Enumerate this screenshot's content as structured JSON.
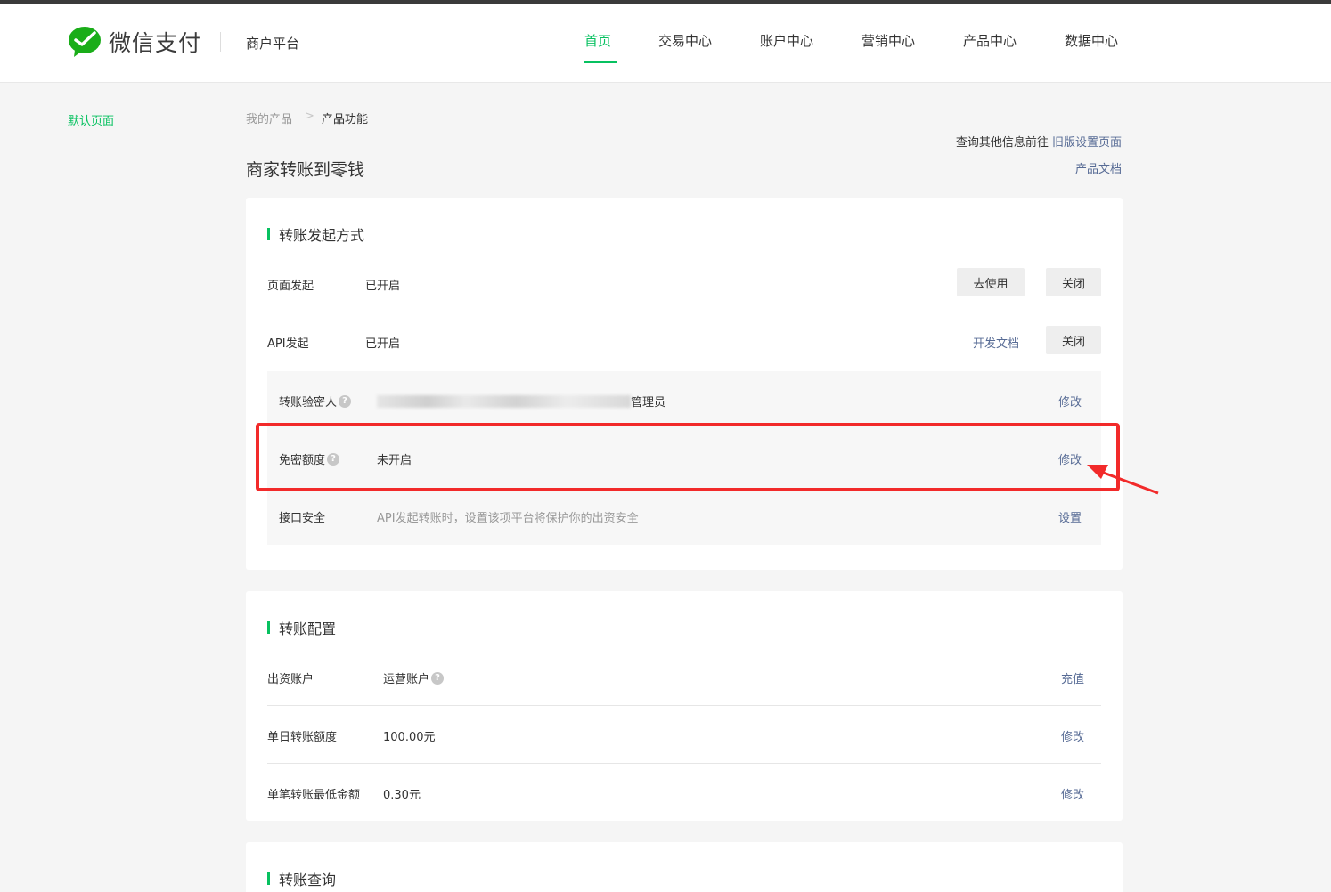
{
  "header": {
    "logo_text": "微信支付",
    "platform": "商户平台",
    "nav": [
      "首页",
      "交易中心",
      "账户中心",
      "营销中心",
      "产品中心",
      "数据中心"
    ],
    "active_nav": "首页"
  },
  "sidebar": {
    "items": [
      {
        "label": "默认页面"
      }
    ]
  },
  "breadcrumb": {
    "items": [
      "我的产品",
      "产品功能"
    ],
    "separator": ">"
  },
  "top_links": {
    "query_text": "查询其他信息前往",
    "old_settings_link": "旧版设置页面",
    "doc_link": "产品文档"
  },
  "page": {
    "title": "商家转账到零钱"
  },
  "section1": {
    "title": "转账发起方式",
    "page_initiate": {
      "label": "页面发起",
      "status": "已开启",
      "use_button": "去使用",
      "close_button": "关闭"
    },
    "api_initiate": {
      "label": "API发起",
      "status": "已开启",
      "dev_doc_link": "开发文档",
      "close_button": "关闭"
    },
    "verifier": {
      "label": "转账验密人",
      "value_suffix": "管理员",
      "action": "修改"
    },
    "free_limit": {
      "label": "免密额度",
      "value": "未开启",
      "action": "修改"
    },
    "api_security": {
      "label": "接口安全",
      "value": "API发起转账时，设置该项平台将保护你的出资安全",
      "action": "设置"
    }
  },
  "section2": {
    "title": "转账配置",
    "funding_account": {
      "label": "出资账户",
      "value": "运营账户",
      "action": "充值"
    },
    "daily_limit": {
      "label": "单日转账额度",
      "value": "100.00元",
      "action": "修改"
    },
    "min_amount": {
      "label": "单笔转账最低金额",
      "value": "0.30元",
      "action": "修改"
    }
  },
  "section3": {
    "title": "转账查询"
  },
  "colors": {
    "brand_green": "#07c160",
    "link_blue": "#576b95",
    "annotation_red": "#f22a2a"
  },
  "icons": [
    "wechat-pay-logo-icon",
    "question-icon",
    "red-arrow-annotation-icon"
  ]
}
